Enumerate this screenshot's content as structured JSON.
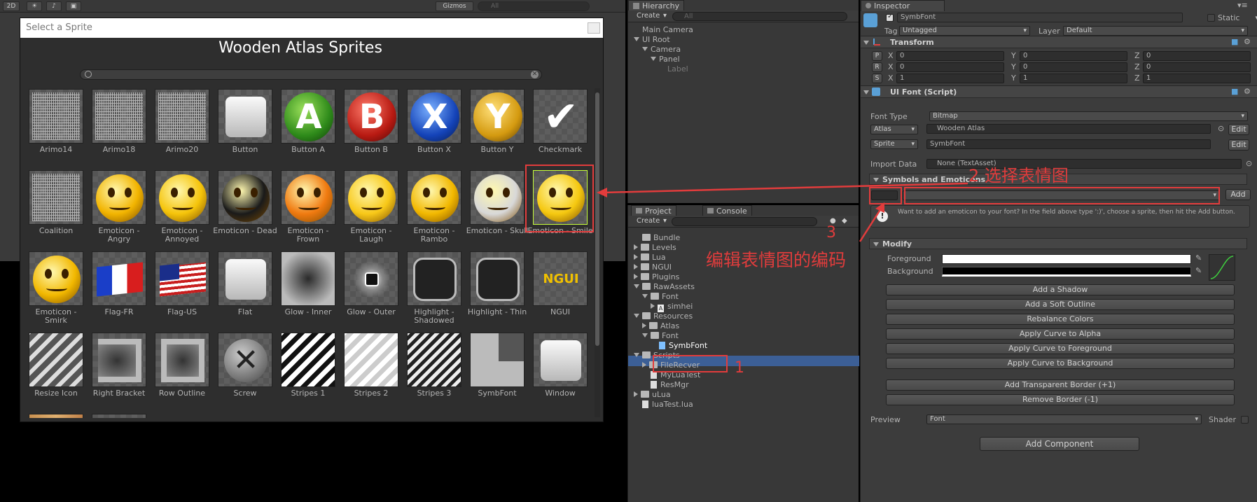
{
  "scene": {
    "mode_2d": "2D",
    "gizmos": "Gizmos",
    "search_all": "All"
  },
  "sprite_selector": {
    "window_title": "Select a Sprite",
    "atlas_title": "Wooden Atlas Sprites",
    "search_placeholder": "",
    "sprites": [
      {
        "name": "Arimo14",
        "kind": "font"
      },
      {
        "name": "Arimo18",
        "kind": "font"
      },
      {
        "name": "Arimo20",
        "kind": "font"
      },
      {
        "name": "Button",
        "kind": "button"
      },
      {
        "name": "Button A",
        "kind": "xbox-a"
      },
      {
        "name": "Button B",
        "kind": "xbox-b"
      },
      {
        "name": "Button X",
        "kind": "xbox-x"
      },
      {
        "name": "Button Y",
        "kind": "xbox-y"
      },
      {
        "name": "Checkmark",
        "kind": "check"
      },
      {
        "name": "Coalition",
        "kind": "font"
      },
      {
        "name": "Emoticon - Angry",
        "kind": "emo-angry"
      },
      {
        "name": "Emoticon - Annoyed",
        "kind": "emo-annoyed"
      },
      {
        "name": "Emoticon - Dead",
        "kind": "emo-dead"
      },
      {
        "name": "Emoticon - Frown",
        "kind": "emo-frown"
      },
      {
        "name": "Emoticon - Laugh",
        "kind": "emo-laugh"
      },
      {
        "name": "Emoticon - Rambo",
        "kind": "emo-rambo"
      },
      {
        "name": "Emoticon - Skull",
        "kind": "emo-skull"
      },
      {
        "name": "Emoticon - Smile",
        "kind": "emo-smile",
        "selected": true
      },
      {
        "name": "Emoticon - Smirk",
        "kind": "emo-smirk"
      },
      {
        "name": "Flag-FR",
        "kind": "flag-fr"
      },
      {
        "name": "Flag-US",
        "kind": "flag-us"
      },
      {
        "name": "Flat",
        "kind": "flat"
      },
      {
        "name": "Glow - Inner",
        "kind": "glow-inner"
      },
      {
        "name": "Glow - Outer",
        "kind": "glow-outer"
      },
      {
        "name": "Highlight - Shadowed",
        "kind": "hl-shadowed"
      },
      {
        "name": "Highlight - Thin",
        "kind": "hl-thin"
      },
      {
        "name": "NGUI",
        "kind": "ngui"
      },
      {
        "name": "Resize Icon",
        "kind": "resize"
      },
      {
        "name": "Right Bracket",
        "kind": "bracket"
      },
      {
        "name": "Row Outline",
        "kind": "row-outline"
      },
      {
        "name": "Screw",
        "kind": "screw"
      },
      {
        "name": "Stripes 1",
        "kind": "stripes1"
      },
      {
        "name": "Stripes 2",
        "kind": "stripes2"
      },
      {
        "name": "Stripes 3",
        "kind": "stripes3"
      },
      {
        "name": "SymbFont",
        "kind": "symbfont"
      },
      {
        "name": "Window",
        "kind": "window"
      },
      {
        "name": "",
        "kind": "wood"
      },
      {
        "name": "",
        "kind": "partial"
      }
    ]
  },
  "hierarchy": {
    "tab": "Hierarchy",
    "create": "Create",
    "search_placeholder": "All",
    "items": [
      {
        "label": "Main Camera",
        "depth": 0,
        "expand": "none"
      },
      {
        "label": "UI Root",
        "depth": 0,
        "expand": "open"
      },
      {
        "label": "Camera",
        "depth": 1,
        "expand": "open"
      },
      {
        "label": "Panel",
        "depth": 2,
        "expand": "open"
      },
      {
        "label": "Label",
        "depth": 3,
        "expand": "none",
        "dim": true
      }
    ]
  },
  "project": {
    "tab_project": "Project",
    "tab_console": "Console",
    "create": "Create",
    "items": [
      {
        "label": "Bundle",
        "depth": 0,
        "expand": "none",
        "type": "folder"
      },
      {
        "label": "Levels",
        "depth": 0,
        "expand": "closed",
        "type": "folder"
      },
      {
        "label": "Lua",
        "depth": 0,
        "expand": "closed",
        "type": "folder"
      },
      {
        "label": "NGUI",
        "depth": 0,
        "expand": "closed",
        "type": "folder"
      },
      {
        "label": "Plugins",
        "depth": 0,
        "expand": "closed",
        "type": "folder"
      },
      {
        "label": "RawAssets",
        "depth": 0,
        "expand": "open",
        "type": "folder"
      },
      {
        "label": "Font",
        "depth": 1,
        "expand": "open",
        "type": "folder"
      },
      {
        "label": "simhei",
        "depth": 2,
        "expand": "closed",
        "type": "font"
      },
      {
        "label": "Resources",
        "depth": 0,
        "expand": "open",
        "type": "folder"
      },
      {
        "label": "Atlas",
        "depth": 1,
        "expand": "closed",
        "type": "folder"
      },
      {
        "label": "Font",
        "depth": 1,
        "expand": "open",
        "type": "folder"
      },
      {
        "label": "SymbFont",
        "depth": 2,
        "expand": "none",
        "type": "prefab",
        "selected": true
      },
      {
        "label": "Scripts",
        "depth": 0,
        "expand": "open",
        "type": "folder"
      },
      {
        "label": "FileRecver",
        "depth": 1,
        "expand": "closed",
        "type": "folder"
      },
      {
        "label": "MyLuaTest",
        "depth": 1,
        "expand": "none",
        "type": "file"
      },
      {
        "label": "ResMgr",
        "depth": 1,
        "expand": "none",
        "type": "file"
      },
      {
        "label": "uLua",
        "depth": 0,
        "expand": "closed",
        "type": "folder"
      },
      {
        "label": "luaTest.lua",
        "depth": 0,
        "expand": "none",
        "type": "file"
      }
    ]
  },
  "inspector": {
    "tab": "Inspector",
    "object_name": "SymbFont",
    "static_label": "Static",
    "tag_label": "Tag",
    "tag_value": "Untagged",
    "layer_label": "Layer",
    "layer_value": "Default",
    "transform": {
      "title": "Transform",
      "rows": [
        {
          "btn": "P",
          "x": "0",
          "y": "0",
          "z": "0"
        },
        {
          "btn": "R",
          "x": "0",
          "y": "0",
          "z": "0"
        },
        {
          "btn": "S",
          "x": "1",
          "y": "1",
          "z": "1"
        }
      ],
      "axis_x": "X",
      "axis_y": "Y",
      "axis_z": "Z"
    },
    "uifont": {
      "title": "UI Font (Script)",
      "font_type_label": "Font Type",
      "font_type_value": "Bitmap",
      "atlas_dd": "Atlas",
      "atlas_value": "Wooden Atlas",
      "edit": "Edit",
      "sprite_dd": "Sprite",
      "sprite_value": "SymbFont",
      "import_label": "Import Data",
      "import_value": "None (TextAsset)",
      "symbols_section": "Symbols and Emoticons",
      "add_button": "Add",
      "help_text": "Want to add an emoticon to your font? In the field above type ':)', choose a sprite, then hit the Add button.",
      "modify_section": "Modify",
      "foreground_label": "Foreground",
      "background_label": "Background",
      "buttons": [
        "Add a Shadow",
        "Add a Soft Outline",
        "Rebalance Colors",
        "Apply Curve to Alpha",
        "Apply Curve to Foreground",
        "Apply Curve to Background"
      ],
      "border_buttons": [
        "Add Transparent Border (+1)",
        "Remove Border (-1)"
      ],
      "preview_label": "Preview",
      "preview_value": "Font",
      "shader_label": "Shader"
    },
    "add_component": "Add Component"
  },
  "annotations": {
    "step1": "1",
    "step2": "2 选择表情图",
    "step3": "3",
    "step3_text": "编辑表情图的编码"
  },
  "colors": {
    "annotation_red": "#e23c3c",
    "selection_blue": "#3c5f96",
    "selected_sprite_outline": "#c7ff3a"
  }
}
